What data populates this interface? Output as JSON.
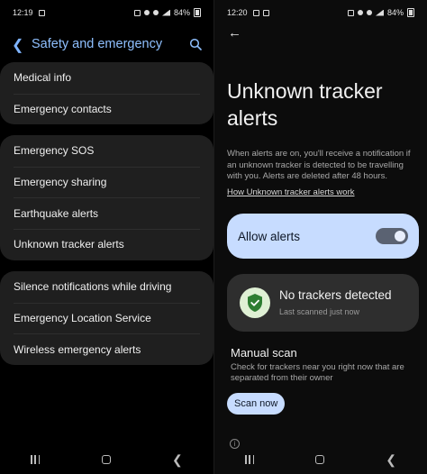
{
  "left": {
    "status": {
      "time": "12:19",
      "battery": "84%"
    },
    "title": "Safety and emergency",
    "groups": [
      {
        "items": [
          "Medical info",
          "Emergency contacts"
        ]
      },
      {
        "items": [
          "Emergency SOS",
          "Emergency sharing",
          "Earthquake alerts",
          "Unknown tracker alerts"
        ]
      },
      {
        "items": [
          "Silence notifications while driving",
          "Emergency Location Service",
          "Wireless emergency alerts"
        ]
      }
    ]
  },
  "right": {
    "status": {
      "time": "12:20",
      "battery": "84%"
    },
    "title": "Unknown tracker alerts",
    "description": "When alerts are on, you'll receive a notification if an unknown tracker is detected to be travelling with you. Alerts are deleted after 48 hours.",
    "link": "How Unknown tracker alerts work",
    "allow_alerts": {
      "label": "Allow alerts",
      "enabled": true
    },
    "status_card": {
      "title": "No trackers detected",
      "subtitle": "Last scanned just now"
    },
    "manual_scan": {
      "title": "Manual scan",
      "description": "Check for trackers near you right now that are separated from their owner",
      "button": "Scan now"
    }
  },
  "colors": {
    "accent_light_blue": "#c7dcff",
    "header_blue": "#8fc0ff",
    "shield_green": "#2e7d32"
  }
}
